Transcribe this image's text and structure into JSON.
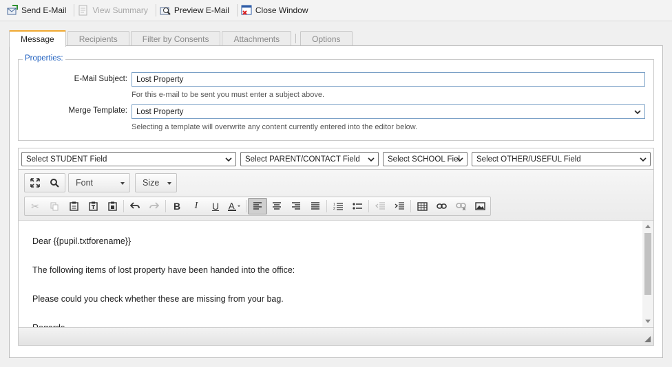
{
  "toolbar": {
    "send": "Send E-Mail",
    "view_summary": "View Summary",
    "preview": "Preview E-Mail",
    "close": "Close Window"
  },
  "tabs": [
    {
      "label": "Message",
      "active": true
    },
    {
      "label": "Recipients",
      "active": false
    },
    {
      "label": "Filter by Consents",
      "active": false
    },
    {
      "label": "Attachments",
      "active": false
    },
    {
      "label": "Options",
      "active": false
    }
  ],
  "properties": {
    "legend": "Properties:",
    "subject_label": "E-Mail Subject:",
    "subject_value": "Lost Property",
    "subject_hint": "For this e-mail to be sent you must enter a subject above.",
    "template_label": "Merge Template:",
    "template_value": "Lost Property",
    "template_hint": "Selecting a template will overwrite any content currently entered into the editor below."
  },
  "merge_fields": {
    "student": "Select STUDENT Field",
    "parent": "Select PARENT/CONTACT Field",
    "school": "Select SCHOOL Fiel",
    "other": "Select OTHER/USEFUL Field"
  },
  "editor": {
    "font_combo": "Font",
    "size_combo": "Size",
    "content": [
      "Dear {{pupil.txtforename}}",
      "",
      "The following items of lost property have been handed into the office:",
      "",
      "Please could you check whether these are missing from your bag.",
      "",
      "Regards"
    ]
  },
  "colors": {
    "accent_tab": "#f0a830",
    "legend": "#1e5fbf",
    "input_border": "#7aa0c6"
  }
}
